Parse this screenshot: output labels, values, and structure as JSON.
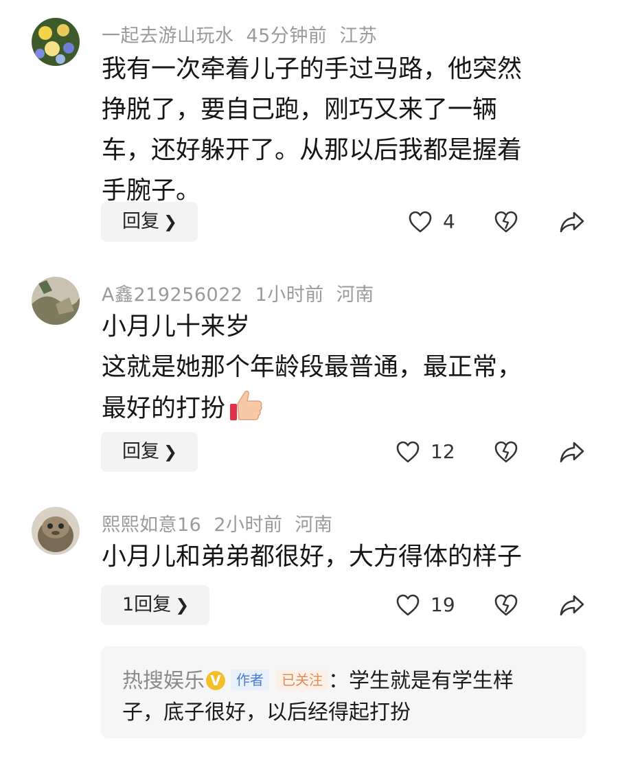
{
  "comments": [
    {
      "username": "一起去游山玩水",
      "time": "45分钟前",
      "location": "江苏",
      "lines": [
        "我有一次牵着儿子的手过马路，他突然",
        "挣脱了，要自己跑，刚巧又来了一辆",
        "车，还好躲开了。从那以后我都是握着",
        "手腕子。"
      ],
      "reply_label": "回复",
      "likes": "4"
    },
    {
      "username": "A鑫219256022",
      "time": "1小时前",
      "location": "河南",
      "lines": [
        "小月儿十来岁",
        "这就是她那个年龄段最普通，最正常，",
        "最好的打扮"
      ],
      "reply_label": "回复",
      "likes": "12"
    },
    {
      "username": "熙熙如意16",
      "time": "2小时前",
      "location": "河南",
      "lines": [
        "小月儿和弟弟都很好，大方得体的样子"
      ],
      "reply_label": "1回复",
      "likes": "19"
    }
  ],
  "author_reply": {
    "name": "热搜娱乐",
    "verified_mark": "V",
    "tag_author": "作者",
    "tag_followed": "已关注",
    "line1": "：学生就是有学生样",
    "line2": "子，底子很好，以后经得起打扮"
  },
  "icons": {
    "like": "heart-outline-icon",
    "dislike": "broken-heart-icon",
    "share": "share-arrow-icon",
    "emoji": "thumbs-up-emoji"
  },
  "colors": {
    "meta": "#9a9a9a",
    "button_bg": "#f3f3f3",
    "verified": "#f4bf2a",
    "tag_author": "#4a7bd0",
    "tag_followed": "#e08a5a"
  }
}
